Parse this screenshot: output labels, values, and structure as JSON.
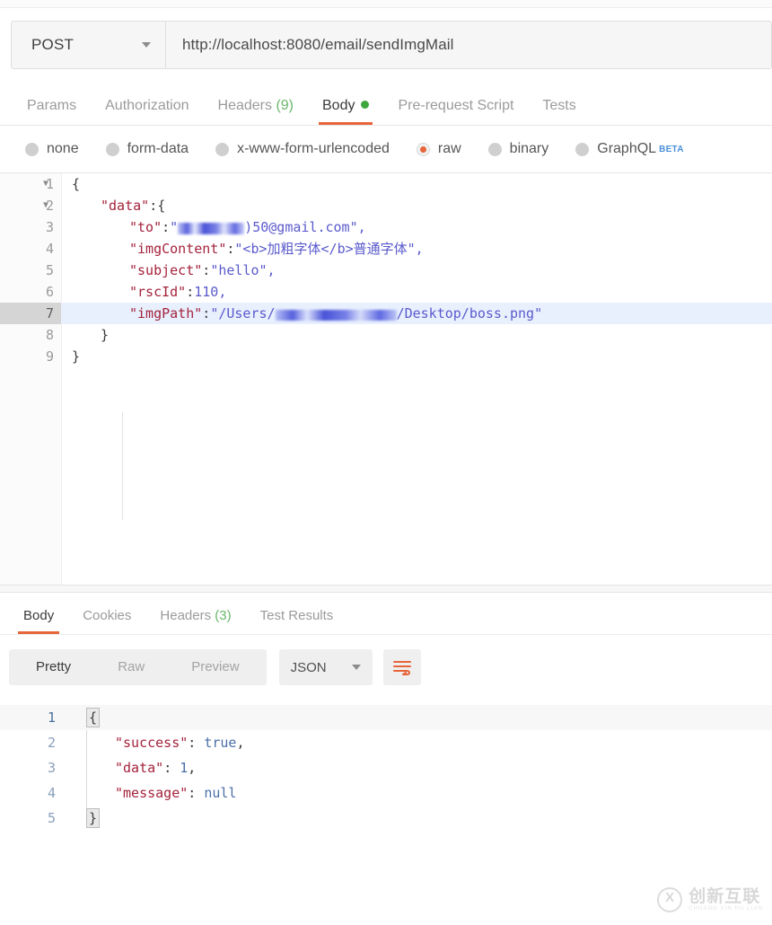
{
  "request": {
    "method": "POST",
    "url": "http://localhost:8080/email/sendImgMail",
    "tabs": [
      {
        "label": "Params",
        "active": false
      },
      {
        "label": "Authorization",
        "active": false
      },
      {
        "label": "Headers",
        "count": "(9)",
        "active": false
      },
      {
        "label": "Body",
        "active": true,
        "dot": true
      },
      {
        "label": "Pre-request Script",
        "active": false
      },
      {
        "label": "Tests",
        "active": false
      }
    ],
    "body_types": [
      {
        "label": "none",
        "selected": false
      },
      {
        "label": "form-data",
        "selected": false
      },
      {
        "label": "x-www-form-urlencoded",
        "selected": false
      },
      {
        "label": "raw",
        "selected": true
      },
      {
        "label": "binary",
        "selected": false
      },
      {
        "label": "GraphQL",
        "selected": false,
        "badge": "BETA"
      }
    ],
    "editor_lines": [
      {
        "num": "1",
        "fold": true,
        "active": false,
        "segments": [
          {
            "t": "{",
            "c": "tk-punc"
          }
        ],
        "indent": 0
      },
      {
        "num": "2",
        "fold": true,
        "active": false,
        "segments": [
          {
            "t": "\"data\"",
            "c": "tk-key"
          },
          {
            "t": ":{",
            "c": "tk-punc"
          }
        ],
        "indent": 1
      },
      {
        "num": "3",
        "fold": false,
        "active": false,
        "segments": [
          {
            "t": "\"to\"",
            "c": "tk-key"
          },
          {
            "t": ":",
            "c": "tk-punc"
          },
          {
            "t": "\"",
            "c": "tk-str"
          },
          {
            "t": "REDACT_TO",
            "c": "redact"
          },
          {
            "t": ")50@gmail.com\",",
            "c": "tk-str"
          }
        ],
        "indent": 2
      },
      {
        "num": "4",
        "fold": false,
        "active": false,
        "segments": [
          {
            "t": "\"imgContent\"",
            "c": "tk-key"
          },
          {
            "t": ":",
            "c": "tk-punc"
          },
          {
            "t": "\"<b>加粗字体</b>普通字体\",",
            "c": "tk-str"
          }
        ],
        "indent": 2
      },
      {
        "num": "5",
        "fold": false,
        "active": false,
        "segments": [
          {
            "t": "\"subject\"",
            "c": "tk-key"
          },
          {
            "t": ":",
            "c": "tk-punc"
          },
          {
            "t": "\"hello\",",
            "c": "tk-str"
          }
        ],
        "indent": 2
      },
      {
        "num": "6",
        "fold": false,
        "active": false,
        "segments": [
          {
            "t": "\"rscId\"",
            "c": "tk-key"
          },
          {
            "t": ":",
            "c": "tk-punc"
          },
          {
            "t": "110,",
            "c": "tk-num"
          }
        ],
        "indent": 2
      },
      {
        "num": "7",
        "fold": false,
        "active": true,
        "segments": [
          {
            "t": "\"imgPath\"",
            "c": "tk-key"
          },
          {
            "t": ":",
            "c": "tk-punc"
          },
          {
            "t": "\"/Users/",
            "c": "tk-str"
          },
          {
            "t": "REDACT_PATH",
            "c": "redact"
          },
          {
            "t": "/Desktop/boss.png\"",
            "c": "tk-str"
          }
        ],
        "indent": 2
      },
      {
        "num": "8",
        "fold": false,
        "active": false,
        "segments": [
          {
            "t": "}",
            "c": "tk-punc"
          }
        ],
        "indent": 1
      },
      {
        "num": "9",
        "fold": false,
        "active": false,
        "segments": [
          {
            "t": "}",
            "c": "tk-punc"
          }
        ],
        "indent": 0
      }
    ]
  },
  "response": {
    "tabs": [
      {
        "label": "Body",
        "active": true
      },
      {
        "label": "Cookies",
        "active": false
      },
      {
        "label": "Headers",
        "count": "(3)",
        "active": false
      },
      {
        "label": "Test Results",
        "active": false
      }
    ],
    "view_modes": [
      {
        "label": "Pretty",
        "active": true
      },
      {
        "label": "Raw",
        "active": false
      },
      {
        "label": "Preview",
        "active": false
      }
    ],
    "format": "JSON",
    "wrap_icon": "wrap-lines-icon",
    "editor_lines": [
      {
        "num": "1",
        "active": true,
        "bracket": "{",
        "segments": []
      },
      {
        "num": "2",
        "active": false,
        "bracket": null,
        "segments": [
          {
            "t": "\"success\"",
            "c": "r-key"
          },
          {
            "t": ": ",
            "c": "r-punc"
          },
          {
            "t": "true",
            "c": "r-val"
          },
          {
            "t": ",",
            "c": "r-punc"
          }
        ]
      },
      {
        "num": "3",
        "active": false,
        "bracket": null,
        "segments": [
          {
            "t": "\"data\"",
            "c": "r-key"
          },
          {
            "t": ": ",
            "c": "r-punc"
          },
          {
            "t": "1",
            "c": "r-val"
          },
          {
            "t": ",",
            "c": "r-punc"
          }
        ]
      },
      {
        "num": "4",
        "active": false,
        "bracket": null,
        "segments": [
          {
            "t": "\"message\"",
            "c": "r-key"
          },
          {
            "t": ": ",
            "c": "r-punc"
          },
          {
            "t": "null",
            "c": "r-val"
          }
        ]
      },
      {
        "num": "5",
        "active": false,
        "bracket": "}",
        "segments": []
      }
    ]
  },
  "watermark": {
    "cn": "创新互联",
    "pinyin": "CHUANG XIN HU LIAN"
  },
  "colors": {
    "accent": "#e8653a",
    "green": "#3ea83e",
    "key": "#a4233c",
    "string": "#5a5acd",
    "active_line": "#e8f0fe"
  }
}
